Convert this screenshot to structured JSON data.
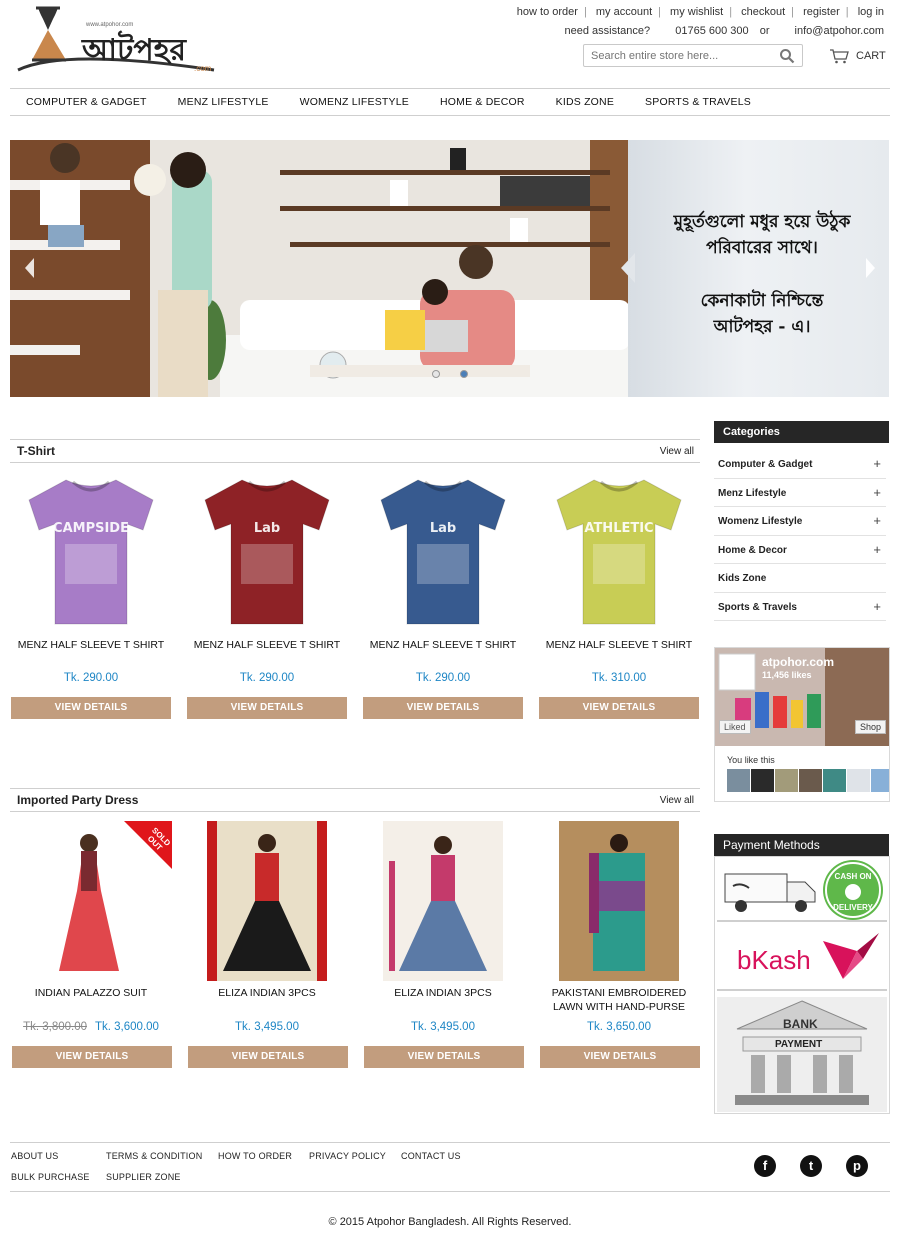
{
  "colors": {
    "accent_button": "#c29d7e",
    "price": "#1e86c5",
    "sidebar_header": "#262626"
  },
  "header": {
    "logo_text": "আটপহর",
    "logo_small_url": "www.atpohor.com",
    "logo_suffix": ".com",
    "top_links": [
      "how to order",
      "my account",
      "my wishlist",
      "checkout",
      "register",
      "log in"
    ],
    "assistance_label": "need assistance?",
    "phone": "01765 600 300",
    "or_text": "or",
    "email": "info@atpohor.com",
    "search_placeholder": "Search entire store here...",
    "cart_label": "CART"
  },
  "nav": [
    "COMPUTER & GADGET",
    "MENZ LIFESTYLE",
    "WOMENZ LIFESTYLE",
    "HOME & DECOR",
    "KIDS ZONE",
    "SPORTS & TRAVELS"
  ],
  "slider": {
    "line1": "মুহূর্তগুলো মধুর হয়ে উঠুক",
    "line2": "পরিবারের সাথে।",
    "line3": "কেনাকাটা নিশ্চিন্তে",
    "line4": "আটপহর - এ।"
  },
  "sections": {
    "tshirt": {
      "title": "T-Shirt",
      "view_all": "View all",
      "products": [
        {
          "name": "MENZ HALF SLEEVE T SHIRT",
          "price": "Tk. 290.00",
          "button": "VIEW DETAILS",
          "color": "#a77cc7",
          "print": "CAMPSIDE"
        },
        {
          "name": "MENZ HALF SLEEVE T SHIRT",
          "price": "Tk. 290.00",
          "button": "VIEW DETAILS",
          "color": "#8e2226",
          "print": "Lab"
        },
        {
          "name": "MENZ HALF SLEEVE T SHIRT",
          "price": "Tk. 290.00",
          "button": "VIEW DETAILS",
          "color": "#375a8f",
          "print": "Lab"
        },
        {
          "name": "MENZ HALF SLEEVE T SHIRT",
          "price": "Tk. 310.00",
          "button": "VIEW DETAILS",
          "color": "#c8cd55",
          "print": "ATHLETIC"
        }
      ]
    },
    "dress": {
      "title": "Imported Party Dress",
      "view_all": "View all",
      "sold_out": "SOLD OUT",
      "products": [
        {
          "name": "INDIAN PALAZZO SUIT",
          "name2": "",
          "old_price": "Tk. 3,800.00",
          "price": "Tk. 3,600.00",
          "button": "VIEW DETAILS"
        },
        {
          "name": "ELIZA INDIAN 3PCS",
          "name2": "",
          "old_price": "",
          "price": "Tk. 3,495.00",
          "button": "VIEW DETAILS"
        },
        {
          "name": "ELIZA INDIAN 3PCS",
          "name2": "",
          "old_price": "",
          "price": "Tk. 3,495.00",
          "button": "VIEW DETAILS"
        },
        {
          "name": "PAKISTANI EMBROIDERED",
          "name2": "LAWN WITH HAND-PURSE",
          "old_price": "",
          "price": "Tk. 3,650.00",
          "button": "VIEW DETAILS"
        }
      ]
    }
  },
  "sidebar": {
    "categories_title": "Categories",
    "categories": [
      {
        "label": "Computer & Gadget",
        "plus": "+"
      },
      {
        "label": "Menz Lifestyle",
        "plus": "+"
      },
      {
        "label": "Womenz Lifestyle",
        "plus": "+"
      },
      {
        "label": "Home & Decor",
        "plus": "+"
      },
      {
        "label": "Kids Zone",
        "plus": ""
      },
      {
        "label": "Sports & Travels",
        "plus": "+"
      }
    ],
    "facebook": {
      "page": "atpohor.com",
      "likes": "11,456 likes",
      "liked": "Liked",
      "shop": "Shop",
      "you_like": "You like this"
    },
    "payment_title": "Payment Methods",
    "payment": {
      "cod_top": "CASH ON",
      "cod_bottom": "DELIVERY",
      "bkash": "bKash",
      "bank": "BANK",
      "bank_payment": "PAYMENT"
    }
  },
  "footer": {
    "links": [
      "ABOUT US",
      "TERMS & CONDITION",
      "HOW TO ORDER",
      "PRIVACY POLICY",
      "CONTACT US",
      "BULK PURCHASE",
      "SUPPLIER ZONE"
    ],
    "social": [
      "f",
      "t",
      "p"
    ],
    "copyright": "© 2015 Atpohor Bangladesh. All Rights Reserved."
  }
}
